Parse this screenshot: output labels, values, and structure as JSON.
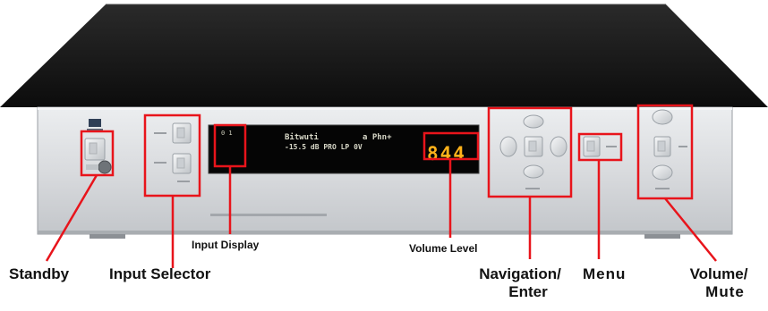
{
  "labels": {
    "standby": "Standby",
    "input_selector": "Input  Selector",
    "input_display": "Input Display",
    "volume_level": "Volume Level",
    "navigation_line1": "Navigation/",
    "navigation_line2": "Enter",
    "menu": "Menu",
    "volume_line1": "Volume/",
    "volume_line2": "Mute"
  },
  "display": {
    "line1_left": "Bitwuti",
    "line1_right": "a Phn+",
    "line2": "-15.5 dB  PRO LP 0V",
    "volume_readout": "844"
  },
  "colors": {
    "callout": "#e8141b",
    "led": "#ffb21a",
    "vfd": "#d8d8c8",
    "chassis_top": "#1a1a1a",
    "faceplate": "#d7d9dc"
  }
}
